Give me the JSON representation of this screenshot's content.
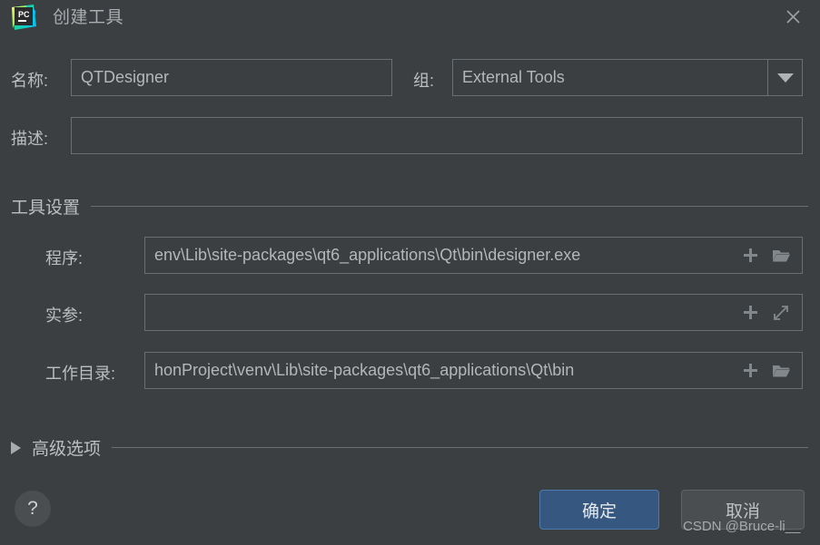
{
  "window": {
    "title": "创建工具",
    "app_icon": "pycharm-icon",
    "close_icon": "close-icon"
  },
  "form": {
    "name": {
      "label": "名称:",
      "value": "QTDesigner",
      "placeholder": ""
    },
    "group": {
      "label": "组:",
      "value": "External Tools",
      "dropdown_icon": "chevron-down-icon"
    },
    "description": {
      "label": "描述:",
      "value": "",
      "placeholder": ""
    }
  },
  "tool_settings": {
    "section_title": "工具设置",
    "program": {
      "label": "程序:",
      "value": "env\\Lib\\site-packages\\qt6_applications\\Qt\\bin\\designer.exe",
      "icons": [
        "plus-icon",
        "folder-icon"
      ]
    },
    "arguments": {
      "label": "实参:",
      "value": "",
      "icons": [
        "plus-icon",
        "expand-icon"
      ]
    },
    "working_directory": {
      "label": "工作目录:",
      "value": "honProject\\venv\\Lib\\site-packages\\qt6_applications\\Qt\\bin",
      "icons": [
        "plus-icon",
        "folder-icon"
      ]
    }
  },
  "advanced": {
    "title": "高级选项",
    "expander_icon": "triangle-right-icon",
    "expanded": false
  },
  "footer": {
    "help_label": "?",
    "ok_label": "确定",
    "cancel_label": "取消"
  },
  "watermark": {
    "text": "CSDN @Bruce-li__"
  },
  "colors": {
    "dialog_bg": "#3c3f41",
    "field_border": "#6a6f73",
    "text": "#b9bcbf",
    "primary_button": "#365880",
    "primary_button_border": "#4c7bb0",
    "secondary_button": "#4a4e51"
  }
}
